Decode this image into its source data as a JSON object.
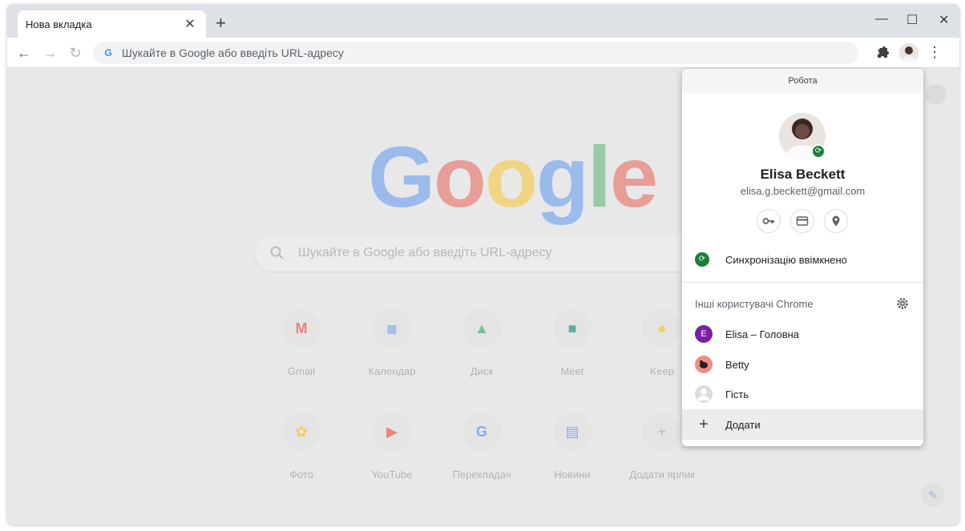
{
  "tab": {
    "title": "Нова вкладка"
  },
  "omnibox": {
    "placeholder": "Шукайте в Google або введіть URL-адресу"
  },
  "logo": {
    "letters": [
      "G",
      "o",
      "o",
      "g",
      "l",
      "e"
    ]
  },
  "search": {
    "placeholder": "Шукайте в Google або введіть URL-адресу"
  },
  "shortcuts": [
    {
      "label": "Gmail",
      "icon": "gmail-icon"
    },
    {
      "label": "Календар",
      "icon": "calendar-icon"
    },
    {
      "label": "Диск",
      "icon": "drive-icon"
    },
    {
      "label": "Meet",
      "icon": "meet-icon"
    },
    {
      "label": "Keep",
      "icon": "keep-icon"
    },
    {
      "label": "Фото",
      "icon": "photos-icon"
    },
    {
      "label": "YouTube",
      "icon": "youtube-icon"
    },
    {
      "label": "Перекладач",
      "icon": "translate-icon"
    },
    {
      "label": "Новини",
      "icon": "news-icon"
    },
    {
      "label": "Додати ярлик",
      "icon": "add-icon"
    }
  ],
  "profile_menu": {
    "header": "Робота",
    "name": "Elisa Beckett",
    "email": "elisa.g.beckett@gmail.com",
    "sync_status": "Синхронізацію ввімкнено",
    "others_label": "Інші користувачі Chrome",
    "users": [
      {
        "label": "Elisa – Головна",
        "initial": "E",
        "color": "#7b1fa2"
      },
      {
        "label": "Betty",
        "initial": "",
        "color": "#f28b82"
      },
      {
        "label": "Гість",
        "initial": "",
        "color": "#dadce0"
      }
    ],
    "add_label": "Додати"
  },
  "colors": {
    "sync_green": "#188038",
    "accent_blue": "#4285f4"
  }
}
